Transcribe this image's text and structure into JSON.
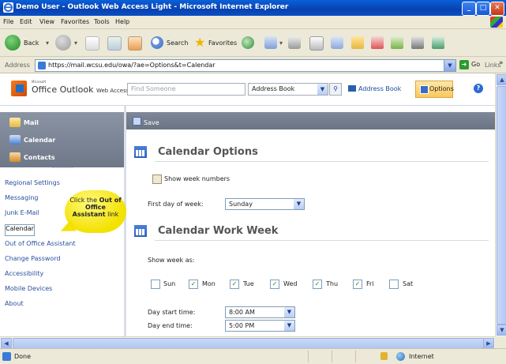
{
  "window": {
    "title": "Demo User - Outlook Web Access Light - Microsoft Internet Explorer",
    "buttons": [
      "_",
      "□",
      "✕"
    ]
  },
  "menu": [
    "File",
    "Edit",
    "View",
    "Favorites",
    "Tools",
    "Help"
  ],
  "toolbar": {
    "back": "Back",
    "search": "Search",
    "favorites": "Favorites"
  },
  "address": {
    "label": "Address",
    "url": "https://mail.wcsu.edu/owa/?ae=Options&t=Calendar",
    "go": "Go",
    "links": "Links"
  },
  "owa": {
    "brand_ms": "Microsoft",
    "brand": "Office Outlook",
    "brand_sub": "Web Access",
    "find_placeholder": "Find Someone",
    "address_book_select": "Address Book",
    "address_book_link": "Address Book",
    "options": "Options",
    "help": "?"
  },
  "nav": {
    "primary": [
      "Mail",
      "Calendar",
      "Contacts"
    ],
    "links": [
      "Regional Settings",
      "Messaging",
      "Junk E-Mail",
      "Calendar",
      "Out of Office Assistant",
      "Change Password",
      "Accessibility",
      "Mobile Devices",
      "About"
    ],
    "selected": "Calendar"
  },
  "callout": {
    "pre": "Click the ",
    "bold": "Out of Office Assistant",
    "post": " link"
  },
  "save": "Save",
  "calendar_options": {
    "title": "Calendar Options",
    "show_week_numbers": "Show week numbers",
    "show_week_numbers_checked": false,
    "first_day_label": "First day of week:",
    "first_day_value": "Sunday"
  },
  "work_week": {
    "title": "Calendar Work Week",
    "show_week_as": "Show week as:",
    "days": [
      {
        "label": "Sun",
        "checked": false
      },
      {
        "label": "Mon",
        "checked": true
      },
      {
        "label": "Tue",
        "checked": true
      },
      {
        "label": "Wed",
        "checked": true
      },
      {
        "label": "Thu",
        "checked": true
      },
      {
        "label": "Fri",
        "checked": true
      },
      {
        "label": "Sat",
        "checked": false
      }
    ],
    "day_start_label": "Day start time:",
    "day_start_value": "8:00 AM",
    "day_end_label": "Day end time:",
    "day_end_value": "5:00 PM"
  },
  "status": {
    "text": "Done",
    "zone": "Internet"
  }
}
